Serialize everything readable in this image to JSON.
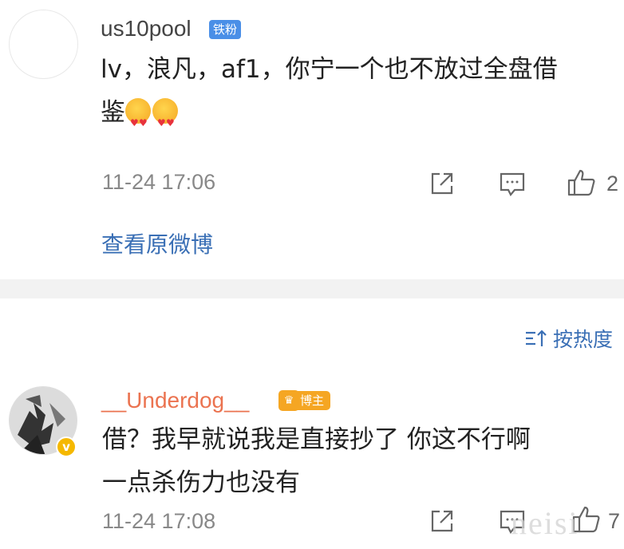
{
  "comments": [
    {
      "username": "us10pool",
      "badge": "铁粉",
      "text_line1": "lv，浪凡，af1，你宁一个也不放过全盘借",
      "text_line2": "鉴",
      "emoji": "heart-eyes-emoji",
      "timestamp": "11-24  17:06",
      "like_count": "2",
      "view_original": "查看原微博"
    },
    {
      "username": "__Underdog__",
      "badge": "博主",
      "text_line1": "借？我早就说我是直接抄了  你这不行啊",
      "text_line2": "一点杀伤力也没有",
      "timestamp": "11-24  17:08",
      "like_count": "7"
    }
  ],
  "sort": {
    "label": "按热度"
  },
  "watermark": "neisi",
  "colors": {
    "link": "#3a6fb5",
    "host_name": "#eb7350",
    "fan_badge": "#4a8fe7",
    "host_badge": "#f5a623",
    "divider": "#f2f2f2"
  }
}
